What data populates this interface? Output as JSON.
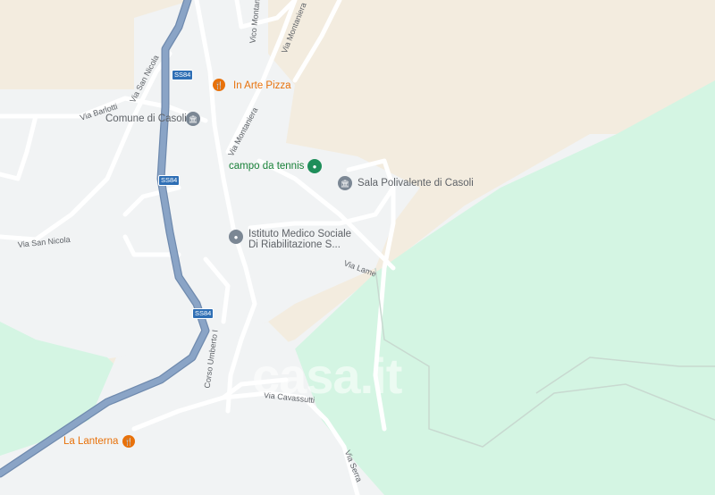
{
  "map": {
    "roads": {
      "ss84": "SS84",
      "via_san_nicola": "Via San Nicola",
      "via_barlotti": "Via Barlotti",
      "vico_montaniera": "Vico Montaniera",
      "via_montaniera": "Via Montaniera",
      "via_lame": "Via Lame",
      "corso_umberto": "Corso Umberto I",
      "via_cavassutti": "Via Cavassutti",
      "via_serra": "Via Serra"
    },
    "pois": {
      "in_arte_pizza": "In Arte Pizza",
      "comune_di_casoli": "Comune di Casoli",
      "campo_da_tennis": "campo da tennis",
      "sala_polivalente": "Sala Polivalente di Casoli",
      "istituto_line1": "Istituto Medico Sociale",
      "istituto_line2": "Di Riabilitazione S...",
      "la_lanterna": "La Lanterna"
    },
    "watermark": "casa.it",
    "colors": {
      "land": "#f1f3f4",
      "urban": "#f3ecdf",
      "park": "#d4f5e3",
      "highway": "#8aa4c6",
      "road": "#ffffff",
      "restaurant": "#e8710a",
      "park_poi": "#1e8e5a",
      "generic_poi": "#7b8794"
    }
  }
}
